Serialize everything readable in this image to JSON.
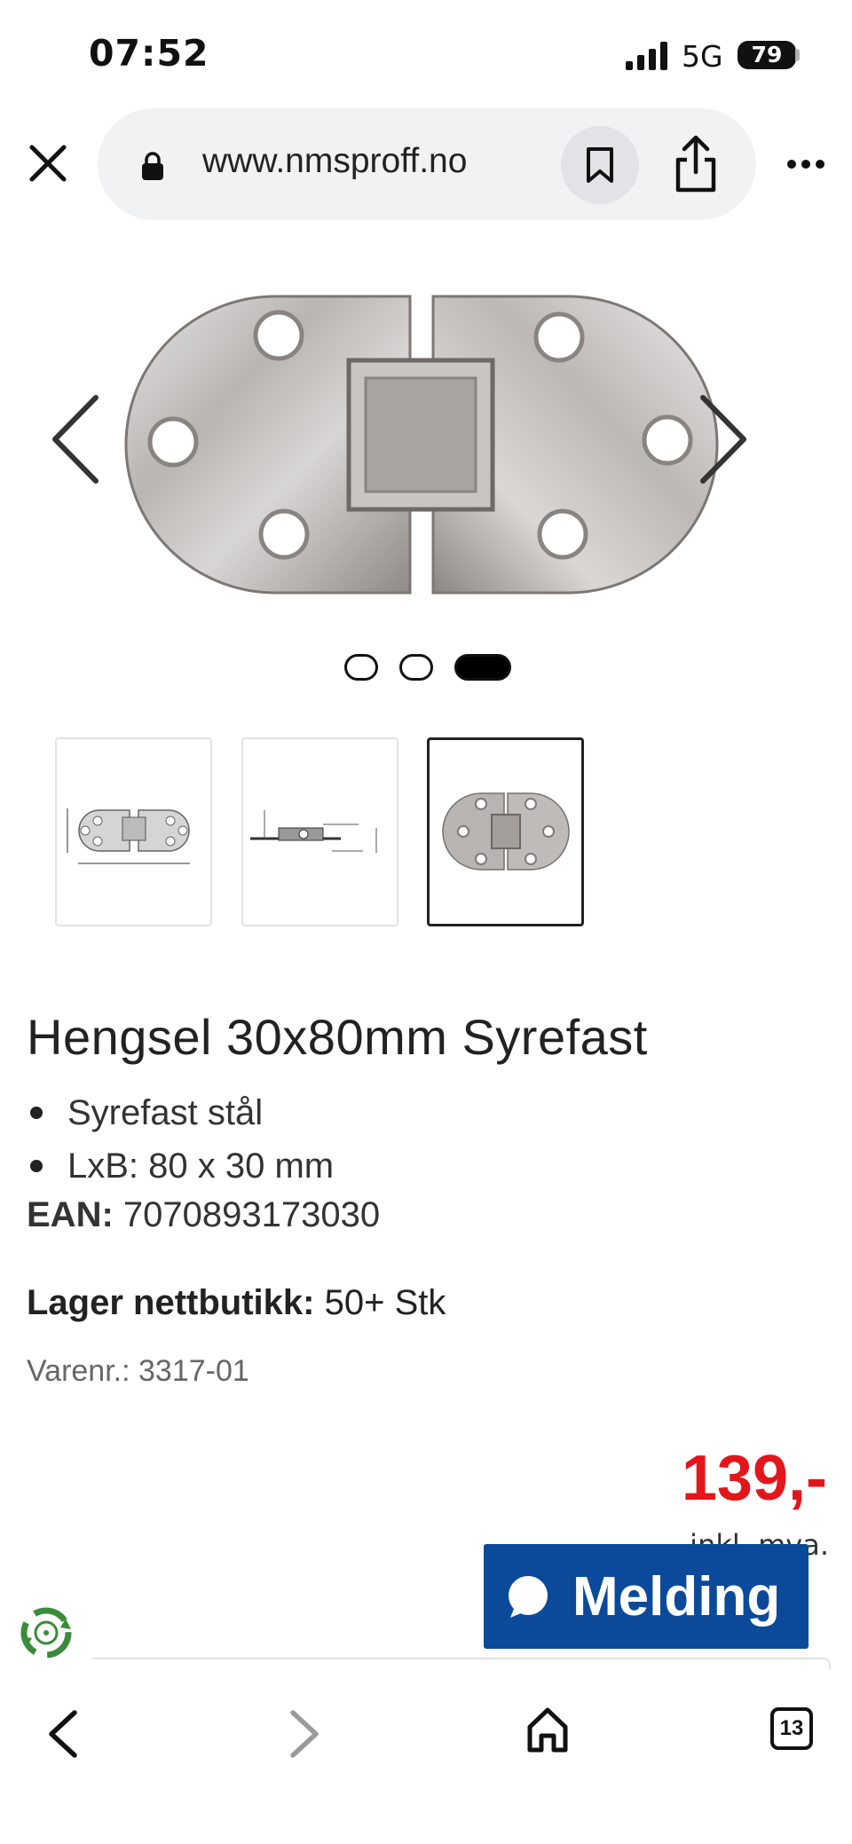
{
  "status_bar": {
    "time": "07:52",
    "network": "5G",
    "battery": "79"
  },
  "browser": {
    "url": "www.nmsproff.no",
    "open_tabs": "13"
  },
  "gallery": {
    "image_count": 3,
    "active_index": 2,
    "main_image": "hinge-photo",
    "thumbnails": [
      "hinge-dimension-drawing",
      "hinge-side-profile-drawing",
      "hinge-photo"
    ]
  },
  "product": {
    "title": "Hengsel 30x80mm Syrefast",
    "features": [
      "Syrefast stål",
      "LxB: 80 x 30 mm"
    ],
    "ean_label": "EAN:",
    "ean_value": "7070893173030",
    "stock_label": "Lager nettbutikk:",
    "stock_value": "50+ Stk",
    "sku_label": "Varenr.:",
    "sku_value": "3317-01",
    "price": "139,-",
    "price_note": "inkl. mva."
  },
  "chat": {
    "label": "Melding"
  },
  "colors": {
    "price": "#e3161b",
    "chat_button": "#0b4a9a",
    "url_bar": "#f1f2f4",
    "eco_badge": "#3a8c3a"
  }
}
